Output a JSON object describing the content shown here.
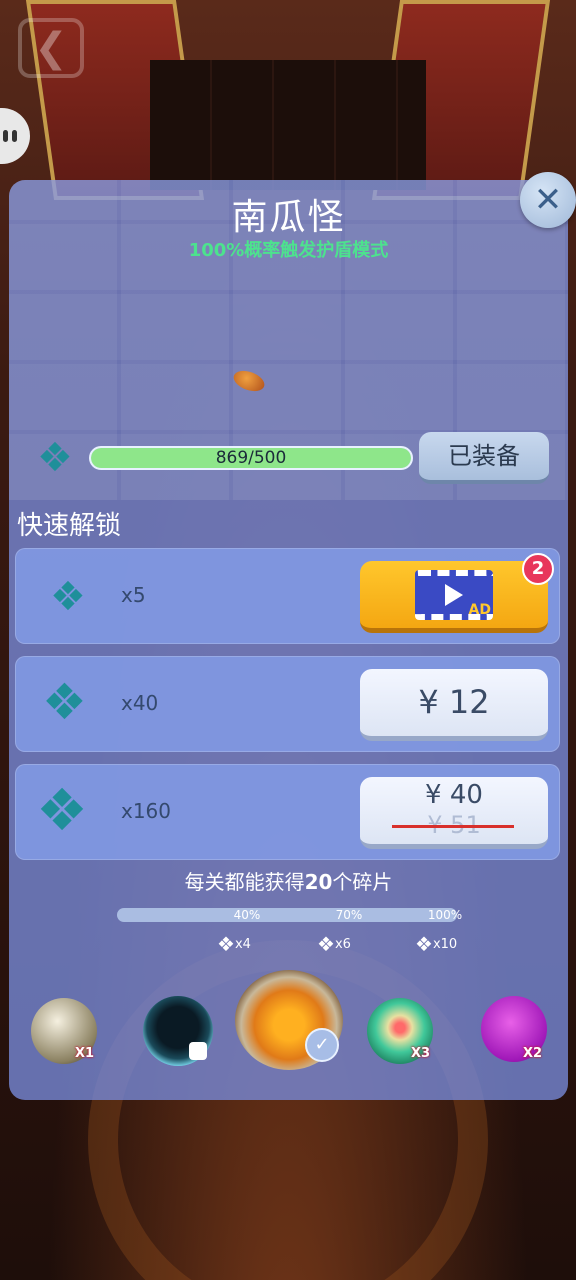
{
  "header": {
    "back_icon": "back-arrow-icon",
    "chat_icon": "chat-icon"
  },
  "dialog": {
    "title": "南瓜怪",
    "subtitle": "100%概率触发护盾模式",
    "close_icon": "close-icon"
  },
  "progress": {
    "current": 869,
    "target": 500,
    "fraction": 1.0,
    "text": "869/500",
    "icon": "puzzle-piece-icon",
    "equip_label": "已装备"
  },
  "quick_unlock": {
    "title": "快速解锁",
    "offers": [
      {
        "qty": "x5",
        "action": "watch-ad",
        "ad_count": "2",
        "ad_label": "AD"
      },
      {
        "qty": "x40",
        "price": "¥ 12"
      },
      {
        "qty": "x160",
        "price": "¥ 40",
        "original_price": "¥ 51"
      }
    ]
  },
  "tip": {
    "prefix": "每关都能获得",
    "count": "20",
    "suffix": "个碎片"
  },
  "milestones": [
    {
      "percent": "40%",
      "reward": "x4"
    },
    {
      "percent": "70%",
      "reward": "x6"
    },
    {
      "percent": "100%",
      "reward": "x10"
    }
  ],
  "characters": [
    {
      "name": "soccer-ball",
      "tag": "X1"
    },
    {
      "name": "robot-ball",
      "tag": ""
    },
    {
      "name": "pumpkin",
      "tag": "",
      "selected": true
    },
    {
      "name": "flower-ball",
      "tag": "X3"
    },
    {
      "name": "purple-monster",
      "tag": "X2"
    }
  ],
  "colors": {
    "panel": "#7a8cdc",
    "subtitle_green": "#4de28e",
    "progress_fill": "#8ee68a",
    "ad_button": "#f4a712",
    "badge_red": "#e8365b",
    "puzzle_teal": "#1f8f9a"
  }
}
